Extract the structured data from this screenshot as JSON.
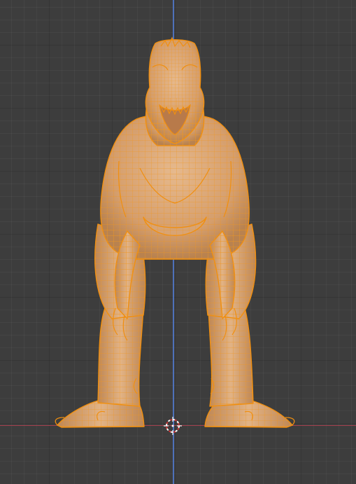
{
  "viewport": {
    "view": "front-orthographic",
    "background_color": "#3d3d3d",
    "grid": true,
    "axes": {
      "x_axis_color": "#a5424f",
      "z_axis_color": "#5077c6"
    }
  },
  "object": {
    "type": "dinosaur-mesh",
    "state": "selected",
    "display": "wireframe-overlay",
    "base_color": "#d9a676",
    "wire_color": "#f0961e"
  },
  "cursor_3d": {
    "icon": "3d-cursor-icon",
    "colors": [
      "#ffffff",
      "#cc3333"
    ]
  }
}
